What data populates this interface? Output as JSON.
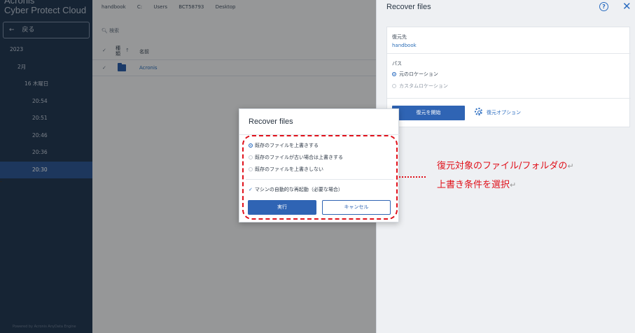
{
  "sidebar": {
    "logo_line1": "Acronis",
    "logo_line2": "Cyber Protect Cloud",
    "back_label": "戻る",
    "back_arrow": "←",
    "year": "2023",
    "month": "2月",
    "day": "16 木曜日",
    "times": [
      "20:54",
      "20:51",
      "20:46",
      "20:36",
      "20:30"
    ],
    "active_time": "20:30",
    "powered_by": "Powered by Acronis AnyData Engine"
  },
  "browser": {
    "breadcrumbs": [
      "handbook",
      "C:",
      "Users",
      "BCT58793",
      "Desktop"
    ],
    "search_placeholder": "検索",
    "col_type_line1": "種",
    "col_type_line2": "類",
    "col_name": "名前",
    "rows": [
      {
        "name": "Acronis",
        "icon": "folder-icon"
      }
    ]
  },
  "panel": {
    "title": "Recover files",
    "help": "?",
    "close": "✕",
    "dest_label": "復元先",
    "dest_value": "handbook",
    "path_label": "パス",
    "path_options": [
      {
        "label": "元のロケーション",
        "selected": true
      },
      {
        "label": "カスタムロケーション",
        "selected": false
      }
    ],
    "start_button": "復元を開始",
    "options_button": "復元オプション"
  },
  "modal": {
    "title": "Recover files",
    "options": [
      {
        "label": "既存のファイルを上書きする",
        "selected": true
      },
      {
        "label": "既存のファイルが古い場合は上書きする",
        "selected": false
      },
      {
        "label": "既存のファイルを上書きしない",
        "selected": false
      }
    ],
    "restart_label": "マシンの自動的な再起動（必要な場合）",
    "restart_checked": true,
    "run_button": "実行",
    "cancel_button": "キャンセル"
  },
  "annotation": {
    "line1": "復元対象のファイル/フォルダの",
    "line2": "上書き条件を選択",
    "return_mark": "↵",
    "color": "#e0101a"
  },
  "colors": {
    "sidebar_bg": "#243a55",
    "accent": "#2f64b4",
    "link": "#2d6fb8"
  }
}
